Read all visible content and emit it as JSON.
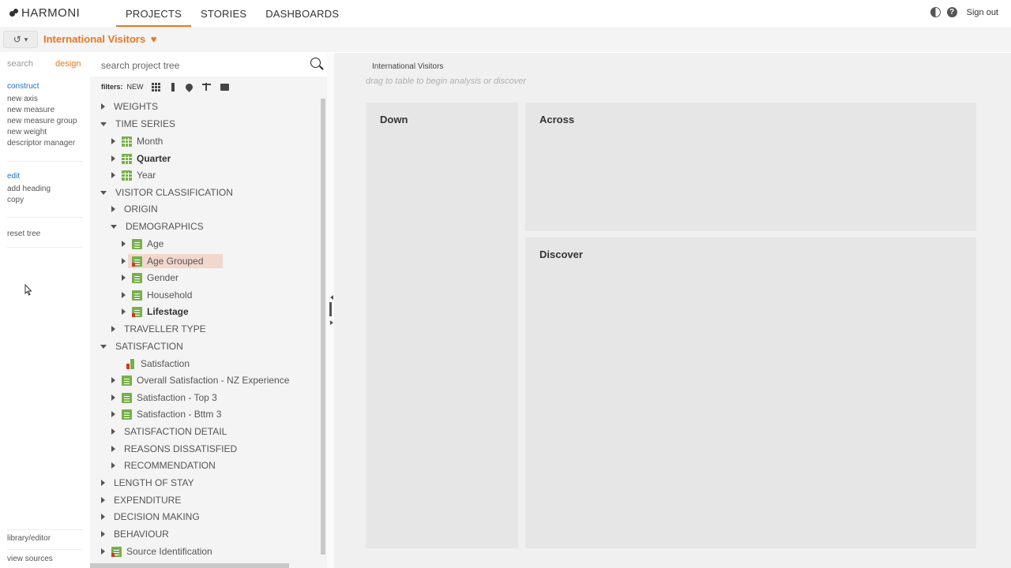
{
  "app": {
    "logo_text": "HARMONI"
  },
  "nav": {
    "projects": "PROJECTS",
    "stories": "STORIES",
    "dashboards": "DASHBOARDS"
  },
  "topright": {
    "signout": "Sign out",
    "help": "?"
  },
  "subbar": {
    "history_icon": "↺",
    "dropdown_icon": "▾",
    "project_title": "International Visitors",
    "heart_icon": "♥"
  },
  "leftpanel": {
    "tabs": {
      "search": "search",
      "design": "design"
    },
    "construct": {
      "head": "construct",
      "links": [
        "new axis",
        "new measure",
        "new measure group",
        "new weight",
        "descriptor manager"
      ]
    },
    "edit": {
      "head": "edit",
      "links": [
        "add heading",
        "copy"
      ]
    },
    "reset": "reset tree",
    "footer": {
      "library": "library/editor",
      "sources": "view sources"
    }
  },
  "tree_panel": {
    "search_placeholder": "search project tree",
    "filters_label": "filters:",
    "filters_new": "NEW",
    "nodes": [
      {
        "label": "WEIGHTS"
      },
      {
        "label": "TIME SERIES"
      },
      {
        "label": "Month"
      },
      {
        "label": "Quarter"
      },
      {
        "label": "Year"
      },
      {
        "label": "VISITOR CLASSIFICATION"
      },
      {
        "label": "ORIGIN"
      },
      {
        "label": "DEMOGRAPHICS"
      },
      {
        "label": "Age"
      },
      {
        "label": "Age Grouped"
      },
      {
        "label": "Gender"
      },
      {
        "label": "Household"
      },
      {
        "label": "Lifestage"
      },
      {
        "label": "TRAVELLER TYPE"
      },
      {
        "label": "SATISFACTION"
      },
      {
        "label": "Satisfaction"
      },
      {
        "label": "Overall Satisfaction - NZ Experience"
      },
      {
        "label": "Satisfaction - Top 3"
      },
      {
        "label": "Satisfaction - Bttm 3"
      },
      {
        "label": "SATISFACTION DETAIL"
      },
      {
        "label": "REASONS DISSATISFIED"
      },
      {
        "label": "RECOMMENDATION"
      },
      {
        "label": "LENGTH OF STAY"
      },
      {
        "label": "EXPENDITURE"
      },
      {
        "label": "DECISION MAKING"
      },
      {
        "label": "BEHAVIOUR"
      },
      {
        "label": "Source Identification"
      }
    ]
  },
  "main": {
    "title": "International Visitors",
    "hint": "drag to table to begin analysis or discover",
    "down": "Down",
    "across": "Across",
    "discover": "Discover"
  },
  "colors": {
    "accent": "#e87722",
    "link": "#1f72b8",
    "icon_green": "#77b04a",
    "icon_red": "#d9342b",
    "selected_bg": "#f2d7cc"
  }
}
